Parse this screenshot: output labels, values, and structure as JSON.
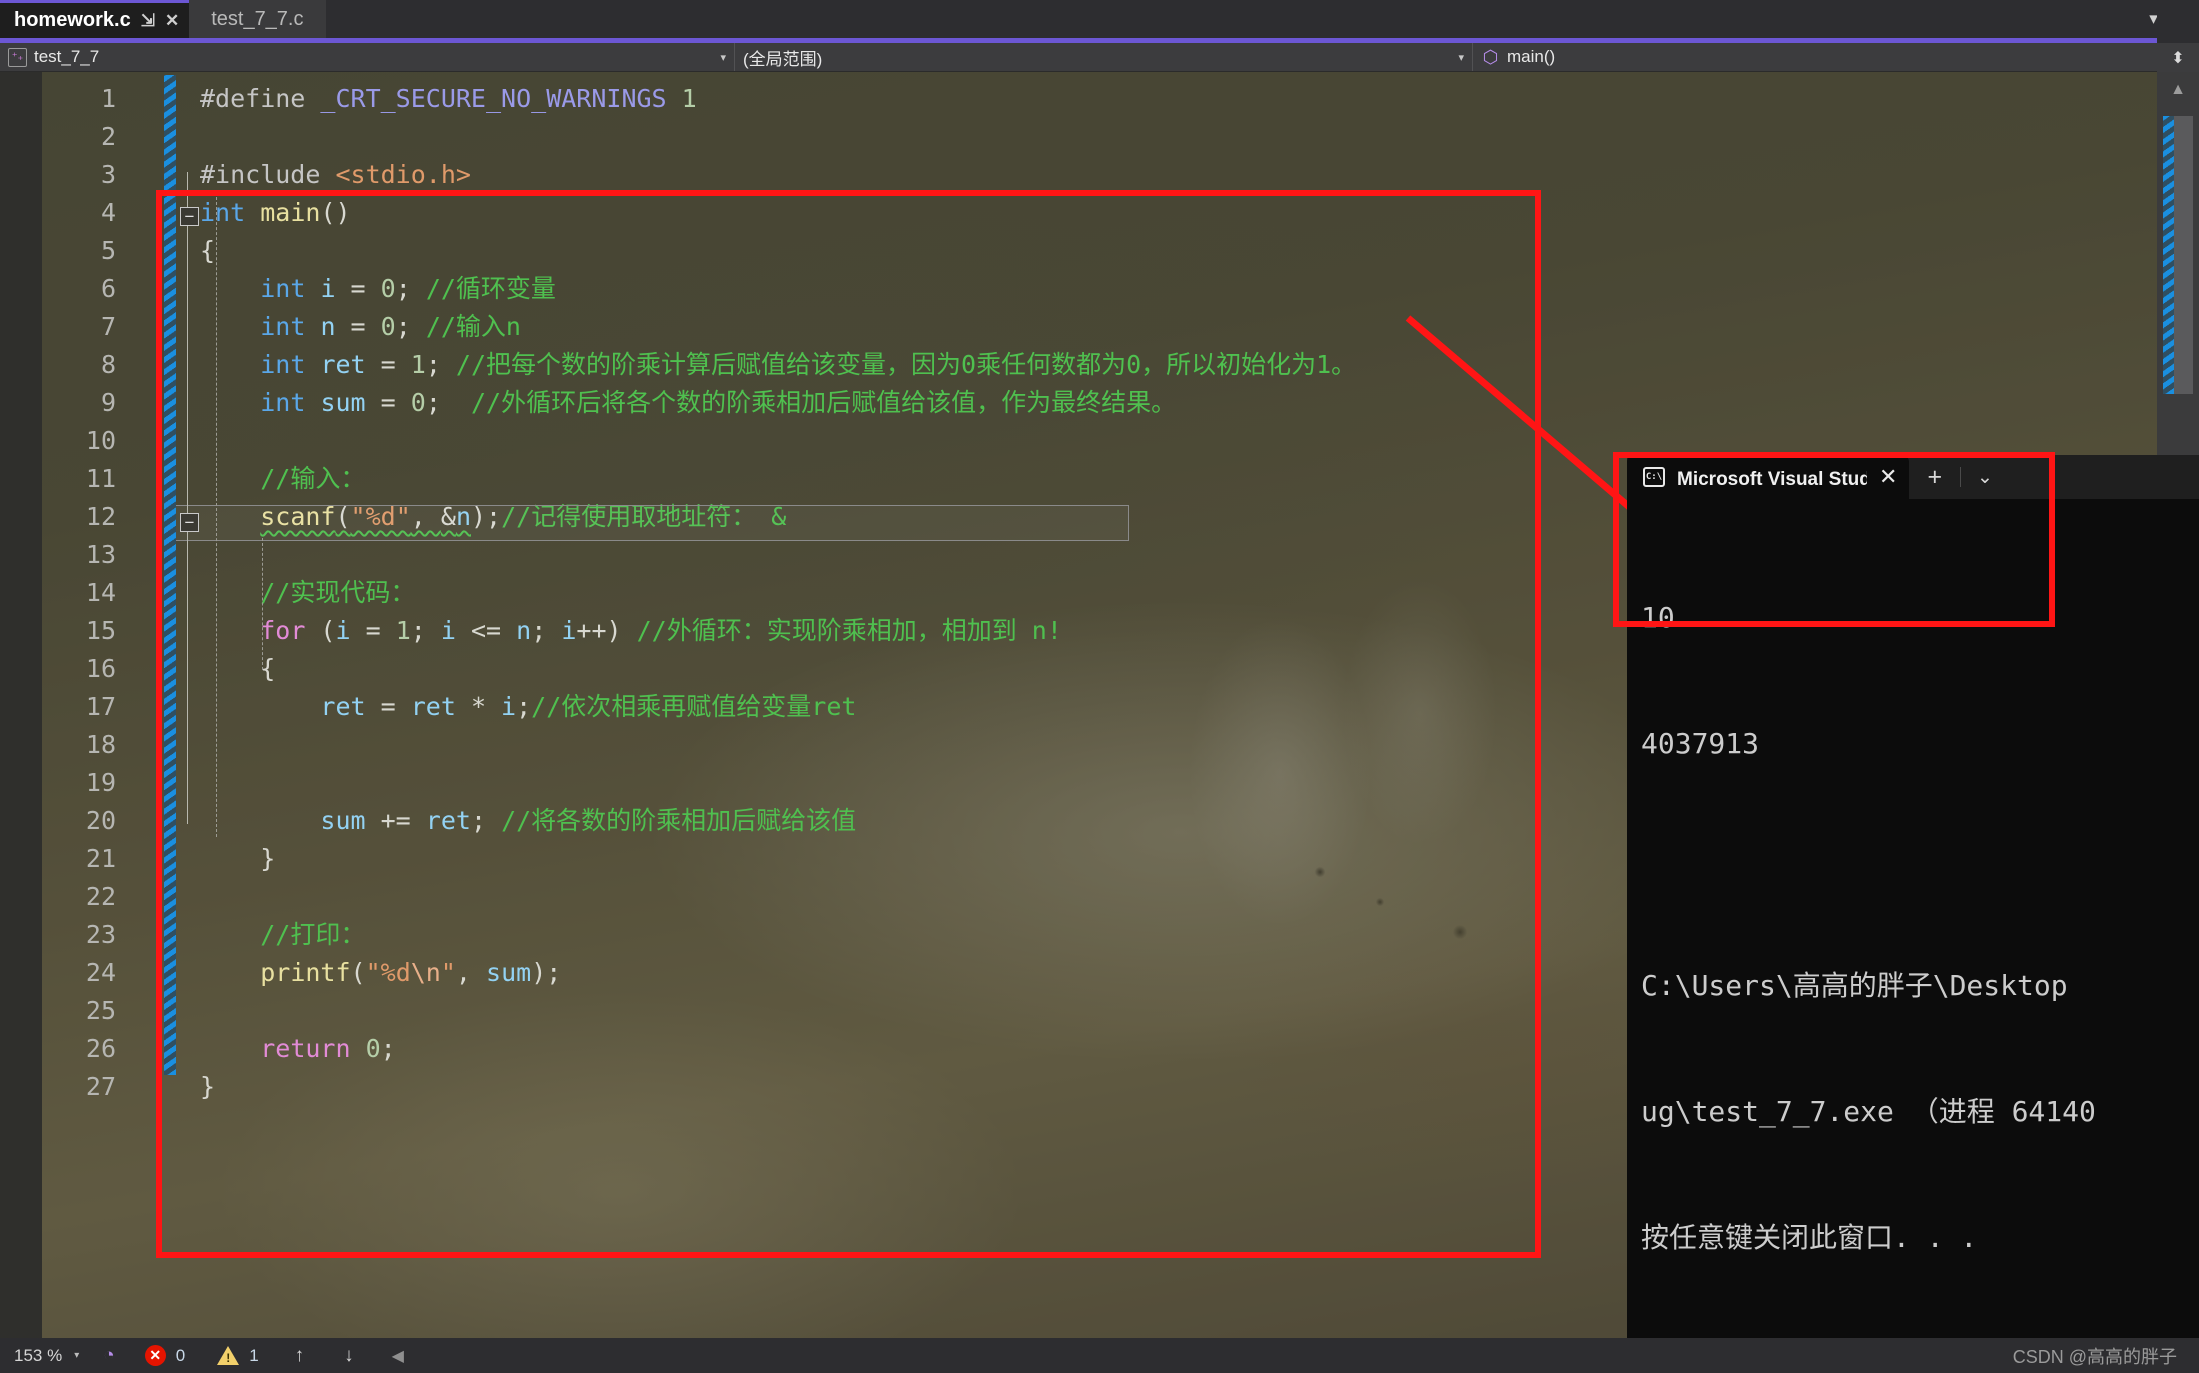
{
  "window": {
    "tabs": [
      {
        "label": "homework.c",
        "active": true,
        "pin": "⇲",
        "close": "✕"
      },
      {
        "label": "test_7_7.c",
        "active": false
      }
    ],
    "tabstrip_caret": "▾",
    "settings_icon": "⚙"
  },
  "navbar": {
    "project": "test_7_7",
    "scope": "(全局范围)",
    "member": "main()",
    "caret": "▾",
    "splitter_icon": "⬍",
    "cpp_glyph": "⁺₊",
    "cube_glyph": "⬡"
  },
  "editor": {
    "fold_collapse": "−",
    "current_line": 15,
    "lines": [
      {
        "n": 1,
        "tokens": [
          {
            "t": "#define ",
            "c": "c-pre"
          },
          {
            "t": "_CRT_SECURE_NO_WARNINGS",
            "c": "c-macro"
          },
          {
            "t": " ",
            "c": "c-plain"
          },
          {
            "t": "1",
            "c": "c-num"
          }
        ]
      },
      {
        "n": 2,
        "tokens": []
      },
      {
        "n": 3,
        "tokens": [
          {
            "t": "#include ",
            "c": "c-pre"
          },
          {
            "t": "<stdio.h>",
            "c": "c-str"
          }
        ]
      },
      {
        "n": 4,
        "tokens": [
          {
            "t": "int",
            "c": "c-kw"
          },
          {
            "t": " ",
            "c": "c-plain"
          },
          {
            "t": "main",
            "c": "c-fn"
          },
          {
            "t": "()",
            "c": "c-punc"
          }
        ]
      },
      {
        "n": 5,
        "tokens": [
          {
            "t": "{",
            "c": "c-punc"
          }
        ]
      },
      {
        "n": 6,
        "tokens": [
          {
            "t": "    ",
            "c": "c-plain"
          },
          {
            "t": "int",
            "c": "c-kw"
          },
          {
            "t": " ",
            "c": "c-plain"
          },
          {
            "t": "i",
            "c": "c-var"
          },
          {
            "t": " = ",
            "c": "c-punc"
          },
          {
            "t": "0",
            "c": "c-num"
          },
          {
            "t": "; ",
            "c": "c-punc"
          },
          {
            "t": "//循环变量",
            "c": "c-cmt"
          }
        ]
      },
      {
        "n": 7,
        "tokens": [
          {
            "t": "    ",
            "c": "c-plain"
          },
          {
            "t": "int",
            "c": "c-kw"
          },
          {
            "t": " ",
            "c": "c-plain"
          },
          {
            "t": "n",
            "c": "c-var"
          },
          {
            "t": " = ",
            "c": "c-punc"
          },
          {
            "t": "0",
            "c": "c-num"
          },
          {
            "t": "; ",
            "c": "c-punc"
          },
          {
            "t": "//输入n",
            "c": "c-cmt"
          }
        ]
      },
      {
        "n": 8,
        "tokens": [
          {
            "t": "    ",
            "c": "c-plain"
          },
          {
            "t": "int",
            "c": "c-kw"
          },
          {
            "t": " ",
            "c": "c-plain"
          },
          {
            "t": "ret",
            "c": "c-var"
          },
          {
            "t": " = ",
            "c": "c-punc"
          },
          {
            "t": "1",
            "c": "c-num"
          },
          {
            "t": "; ",
            "c": "c-punc"
          },
          {
            "t": "//把每个数的阶乘计算后赋值给该变量，因为0乘任何数都为0，所以初始化为1。",
            "c": "c-cmt"
          }
        ]
      },
      {
        "n": 9,
        "tokens": [
          {
            "t": "    ",
            "c": "c-plain"
          },
          {
            "t": "int",
            "c": "c-kw"
          },
          {
            "t": " ",
            "c": "c-plain"
          },
          {
            "t": "sum",
            "c": "c-var"
          },
          {
            "t": " = ",
            "c": "c-punc"
          },
          {
            "t": "0",
            "c": "c-num"
          },
          {
            "t": ";  ",
            "c": "c-punc"
          },
          {
            "t": "//外循环后将各个数的阶乘相加后赋值给该值，作为最终结果。",
            "c": "c-cmt"
          }
        ]
      },
      {
        "n": 10,
        "tokens": []
      },
      {
        "n": 11,
        "tokens": [
          {
            "t": "    ",
            "c": "c-plain"
          },
          {
            "t": "//输入：",
            "c": "c-cmt"
          }
        ]
      },
      {
        "n": 12,
        "tokens": [
          {
            "t": "    ",
            "c": "c-plain"
          },
          {
            "t": "scanf",
            "c": "c-fn",
            "sq": true
          },
          {
            "t": "(",
            "c": "c-punc",
            "sq": true
          },
          {
            "t": "\"%d\"",
            "c": "c-str",
            "sq": true
          },
          {
            "t": ", ",
            "c": "c-punc",
            "sq": true
          },
          {
            "t": "&",
            "c": "c-punc",
            "sq": true
          },
          {
            "t": "n",
            "c": "c-var",
            "sq": true
          },
          {
            "t": ");",
            "c": "c-punc"
          },
          {
            "t": "//记得使用取地址符： &",
            "c": "c-cmt"
          }
        ]
      },
      {
        "n": 13,
        "tokens": []
      },
      {
        "n": 14,
        "tokens": [
          {
            "t": "    ",
            "c": "c-plain"
          },
          {
            "t": "//实现代码：",
            "c": "c-cmt"
          }
        ]
      },
      {
        "n": 15,
        "tokens": [
          {
            "t": "    ",
            "c": "c-plain"
          },
          {
            "t": "for",
            "c": "c-ctrl"
          },
          {
            "t": " (",
            "c": "c-punc"
          },
          {
            "t": "i",
            "c": "c-var"
          },
          {
            "t": " = ",
            "c": "c-punc"
          },
          {
            "t": "1",
            "c": "c-num"
          },
          {
            "t": "; ",
            "c": "c-punc"
          },
          {
            "t": "i",
            "c": "c-var"
          },
          {
            "t": " <= ",
            "c": "c-punc"
          },
          {
            "t": "n",
            "c": "c-var"
          },
          {
            "t": "; ",
            "c": "c-punc"
          },
          {
            "t": "i",
            "c": "c-var"
          },
          {
            "t": "++) ",
            "c": "c-punc"
          },
          {
            "t": "//外循环：实现阶乘相加，相加到 n!",
            "c": "c-cmt"
          }
        ]
      },
      {
        "n": 16,
        "tokens": [
          {
            "t": "    ",
            "c": "c-plain"
          },
          {
            "t": "{",
            "c": "c-punc"
          }
        ]
      },
      {
        "n": 17,
        "tokens": [
          {
            "t": "        ",
            "c": "c-plain"
          },
          {
            "t": "ret",
            "c": "c-var"
          },
          {
            "t": " = ",
            "c": "c-punc"
          },
          {
            "t": "ret",
            "c": "c-var"
          },
          {
            "t": " * ",
            "c": "c-punc"
          },
          {
            "t": "i",
            "c": "c-var"
          },
          {
            "t": ";",
            "c": "c-punc"
          },
          {
            "t": "//依次相乘再赋值给变量ret",
            "c": "c-cmt"
          }
        ]
      },
      {
        "n": 18,
        "tokens": []
      },
      {
        "n": 19,
        "tokens": []
      },
      {
        "n": 20,
        "tokens": [
          {
            "t": "        ",
            "c": "c-plain"
          },
          {
            "t": "sum",
            "c": "c-var"
          },
          {
            "t": " += ",
            "c": "c-punc"
          },
          {
            "t": "ret",
            "c": "c-var"
          },
          {
            "t": "; ",
            "c": "c-punc"
          },
          {
            "t": "//将各数的阶乘相加后赋给该值",
            "c": "c-cmt"
          }
        ]
      },
      {
        "n": 21,
        "tokens": [
          {
            "t": "    ",
            "c": "c-plain"
          },
          {
            "t": "}",
            "c": "c-punc"
          }
        ]
      },
      {
        "n": 22,
        "tokens": []
      },
      {
        "n": 23,
        "tokens": [
          {
            "t": "    ",
            "c": "c-plain"
          },
          {
            "t": "//打印：",
            "c": "c-cmt"
          }
        ]
      },
      {
        "n": 24,
        "tokens": [
          {
            "t": "    ",
            "c": "c-plain"
          },
          {
            "t": "printf",
            "c": "c-fn"
          },
          {
            "t": "(",
            "c": "c-punc"
          },
          {
            "t": "\"%d",
            "c": "c-str"
          },
          {
            "t": "\\n",
            "c": "c-esc"
          },
          {
            "t": "\"",
            "c": "c-str"
          },
          {
            "t": ", ",
            "c": "c-punc"
          },
          {
            "t": "sum",
            "c": "c-var"
          },
          {
            "t": ");",
            "c": "c-punc"
          }
        ]
      },
      {
        "n": 25,
        "tokens": []
      },
      {
        "n": 26,
        "tokens": [
          {
            "t": "    ",
            "c": "c-plain"
          },
          {
            "t": "return",
            "c": "c-ctrl"
          },
          {
            "t": " ",
            "c": "c-plain"
          },
          {
            "t": "0",
            "c": "c-num"
          },
          {
            "t": ";",
            "c": "c-punc"
          }
        ]
      },
      {
        "n": 27,
        "tokens": [
          {
            "t": "}",
            "c": "c-punc"
          }
        ]
      }
    ]
  },
  "console": {
    "title": "Microsoft Visual Studio 调试控",
    "close_label": "✕",
    "new_tab_label": "+",
    "chevron_label": "⌄",
    "terminal_glyph": "C:\\",
    "output_lines": [
      "10",
      "4037913"
    ],
    "info_lines": [
      "C:\\Users\\高高的胖子\\Desktop",
      "ug\\test_7_7.exe （进程 64140",
      "按任意键关闭此窗口. . ."
    ]
  },
  "statusbar": {
    "zoom": "153 %",
    "zoom_caret": "▾",
    "brain_icon": "◔",
    "error_count": "0",
    "warning_count": "1",
    "up_arrow": "↑",
    "down_arrow": "↓",
    "left_tri": "◀",
    "watermark": "CSDN @高高的胖子"
  },
  "rail": {
    "up": "▲",
    "down": "▼"
  },
  "colors": {
    "accent_purple": "#6c57d4",
    "annotation_red": "#ff1515",
    "comment_green": "#4fc04f",
    "keyword_blue": "#5aa7e8",
    "string_orange": "#e09a6a",
    "changebar_blue": "#1a8fe0"
  }
}
